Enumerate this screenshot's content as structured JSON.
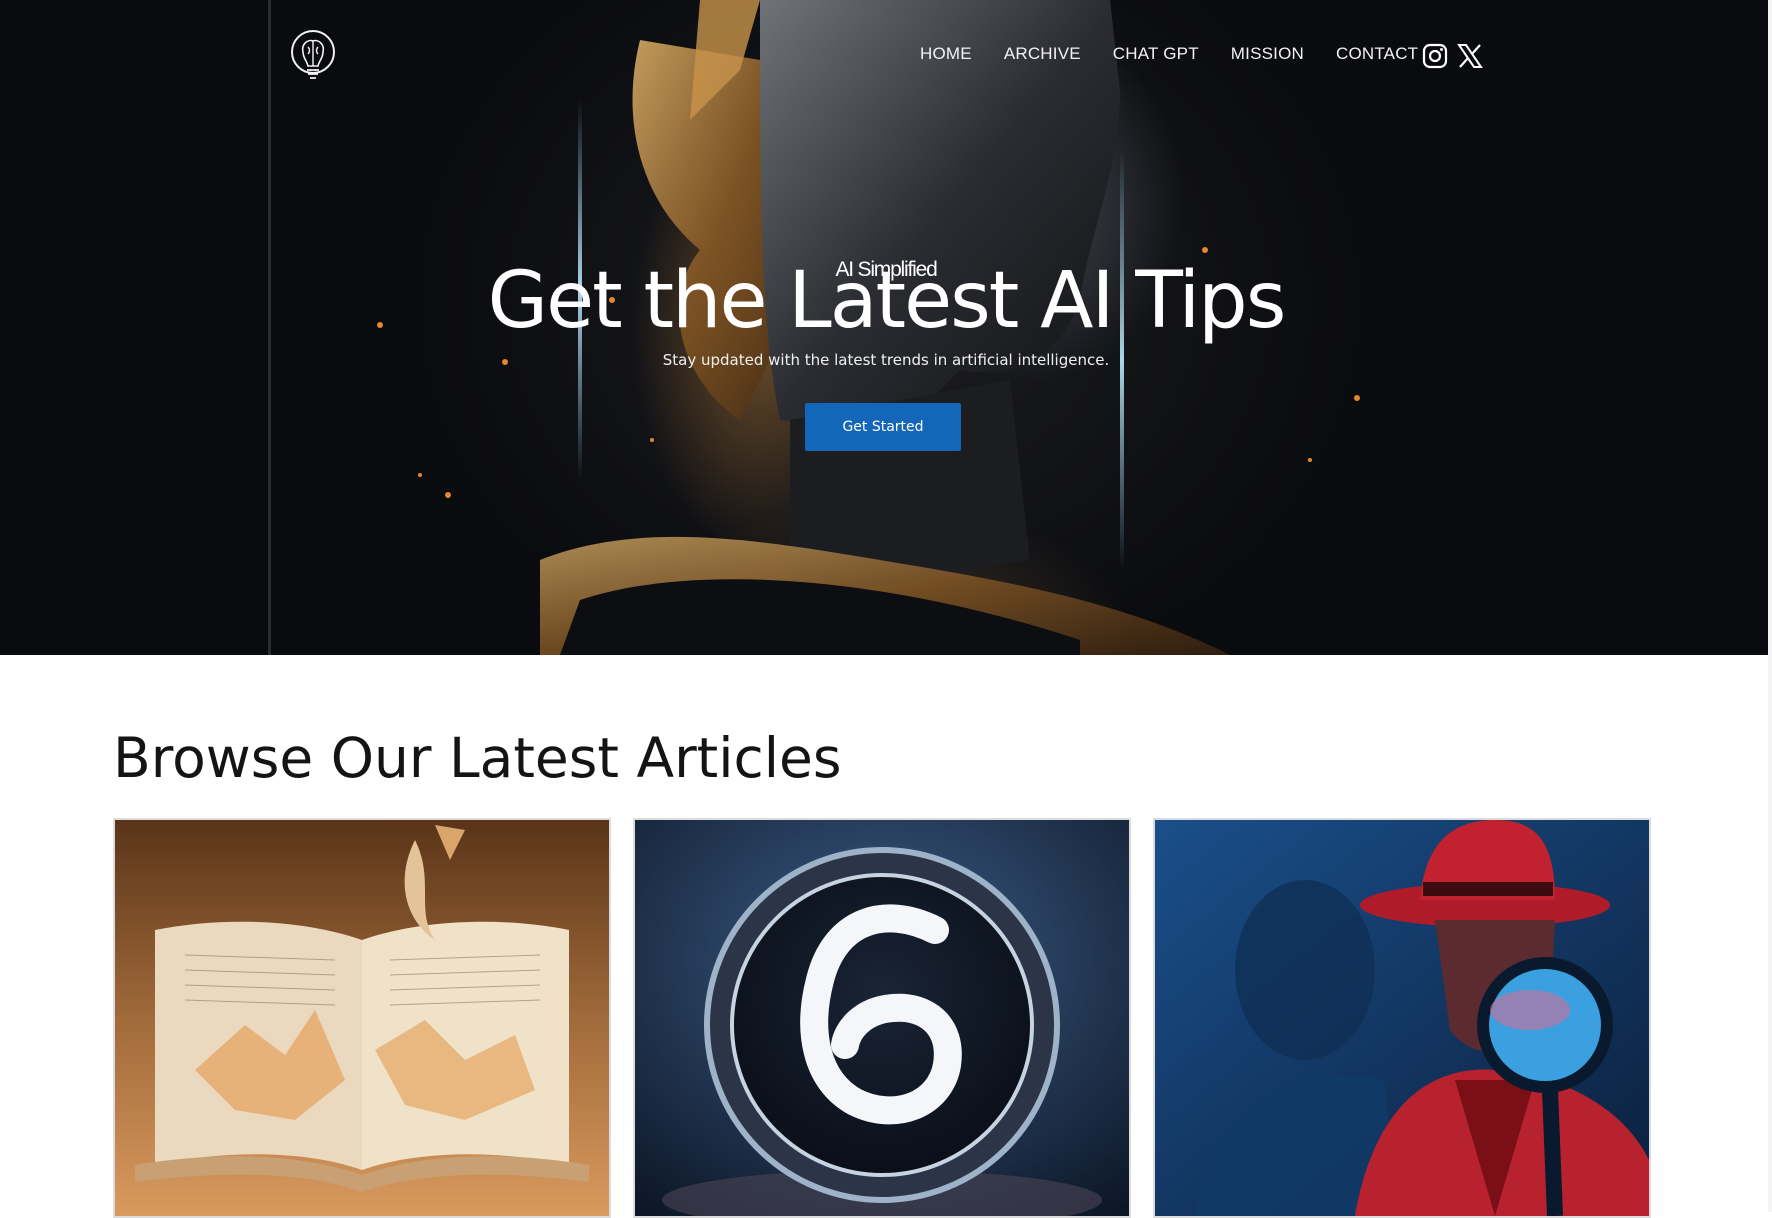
{
  "nav": {
    "logo": "brain-bulb-logo",
    "links": [
      {
        "label": "HOME"
      },
      {
        "label": "ARCHIVE"
      },
      {
        "label": "CHAT GPT"
      },
      {
        "label": "MISSION"
      },
      {
        "label": "CONTACT"
      }
    ],
    "social": [
      {
        "icon": "instagram-icon"
      },
      {
        "icon": "x-twitter-icon"
      }
    ]
  },
  "hero": {
    "eyebrow": "AI Simplified",
    "title": "Get the Latest AI Tips",
    "subtitle": "Stay updated with the latest trends in artificial intelligence.",
    "cta_label": "Get Started",
    "cta_color": "#1466b8"
  },
  "articles": {
    "heading": "Browse Our Latest Articles",
    "cards": [
      {
        "image": "open-book-crumpled-pages-image"
      },
      {
        "image": "number-six-badge-image"
      },
      {
        "image": "detective-magnifying-glass-image"
      }
    ]
  }
}
